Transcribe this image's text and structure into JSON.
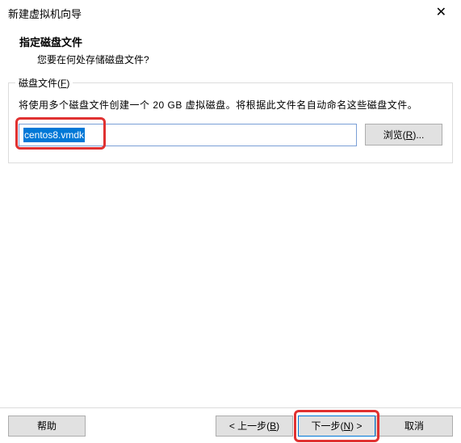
{
  "window": {
    "title": "新建虚拟机向导",
    "close_icon": "✕"
  },
  "header": {
    "title": "指定磁盘文件",
    "subtitle": "您要在何处存储磁盘文件?"
  },
  "group": {
    "legend_base": "磁盘文件(",
    "legend_key": "F",
    "legend_end": ")",
    "description": "将使用多个磁盘文件创建一个 20 GB 虚拟磁盘。将根据此文件名自动命名这些磁盘文件。",
    "file_value": "centos8.vmdk",
    "browse_base": "浏览(",
    "browse_key": "R",
    "browse_end": ")..."
  },
  "footer": {
    "help": "帮助",
    "back_pre": "< 上一步(",
    "back_key": "B",
    "back_end": ")",
    "next_pre": "下一步(",
    "next_key": "N",
    "next_end": ") >",
    "cancel": "取消"
  }
}
